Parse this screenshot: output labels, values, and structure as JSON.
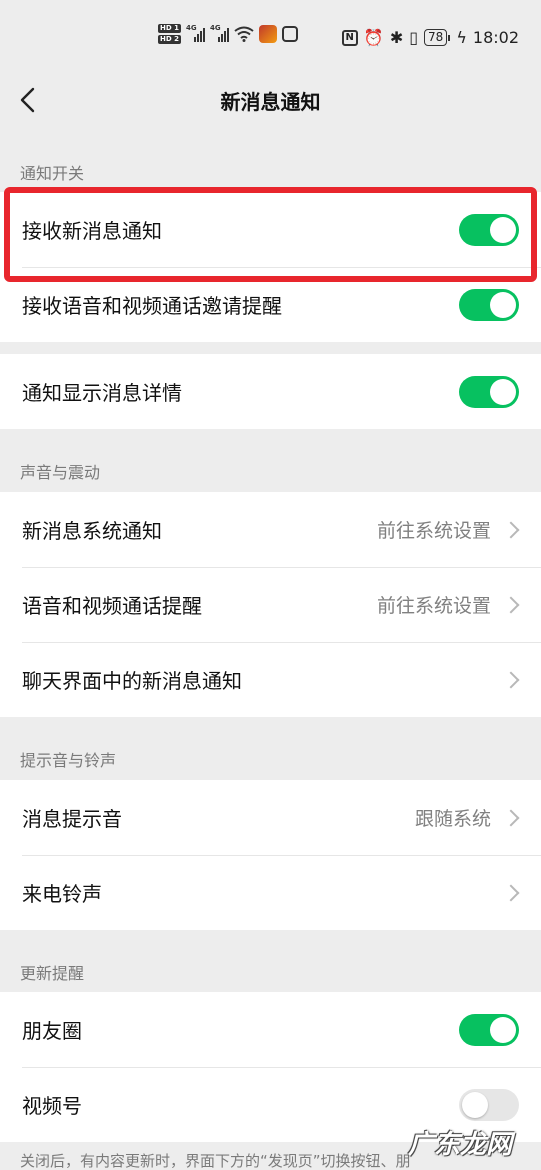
{
  "status_bar": {
    "hd1": "HD 1",
    "hd2": "HD 2",
    "net1": "4G",
    "net2": "4G",
    "battery": "78",
    "time": "18:02"
  },
  "nav": {
    "title": "新消息通知"
  },
  "sections": {
    "notify_switch": "通知开关",
    "sound_vibration": "声音与震动",
    "tones": "提示音与铃声",
    "update_reminder": "更新提醒"
  },
  "rows": {
    "receive_new": {
      "label": "接收新消息通知",
      "on": true
    },
    "receive_call": {
      "label": "接收语音和视频通话邀请提醒",
      "on": true
    },
    "show_detail": {
      "label": "通知显示消息详情",
      "on": true
    },
    "sys_notify": {
      "label": "新消息系统通知",
      "value": "前往系统设置"
    },
    "call_remind": {
      "label": "语音和视频通话提醒",
      "value": "前往系统设置"
    },
    "chat_notify": {
      "label": "聊天界面中的新消息通知"
    },
    "msg_tone": {
      "label": "消息提示音",
      "value": "跟随系统"
    },
    "ringtone": {
      "label": "来电铃声"
    },
    "moments": {
      "label": "朋友圈",
      "on": true
    },
    "channels": {
      "label": "视频号",
      "on": false
    }
  },
  "footer_note": "关闭后，有内容更新时，界面下方的“发现页”切换按钮、朋",
  "watermark": "广东龙网",
  "colors": {
    "accent": "#07c160",
    "highlight": "#e8262d",
    "background": "#ededed"
  }
}
